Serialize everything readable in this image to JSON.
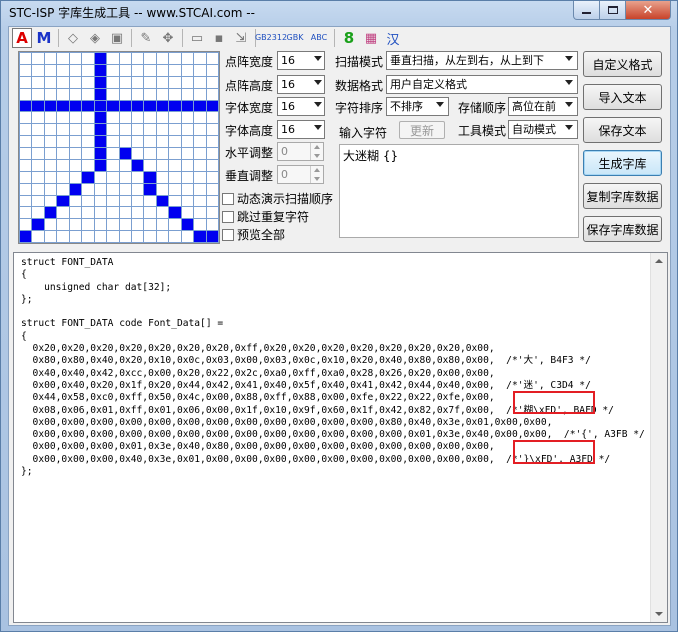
{
  "window": {
    "title": "STC-ISP 字库生成工具 -- www.STCAI.com --"
  },
  "toolbar": {
    "items": [
      "A",
      "M",
      "eraser-icon",
      "fill-icon",
      "stamp-icon",
      "pencil-icon",
      "move-icon",
      "open-icon",
      "save-icon",
      "export-icon",
      "GB2312",
      "GBK",
      "ABC",
      "8",
      "color-grid-icon",
      "汉"
    ]
  },
  "grid": {
    "rows": [
      "0000001000000000",
      "0000001000000000",
      "0000001000000000",
      "0000001000000000",
      "1111111111111111",
      "0000001000000000",
      "0000001000000000",
      "0000001000000000",
      "0000001010000000",
      "0000001001000000",
      "0000010000100000",
      "0000100000100000",
      "0001000000010000",
      "0010000000001000",
      "0100000000000100",
      "1000000000000011"
    ]
  },
  "settings": {
    "matrix_width_label": "点阵宽度",
    "matrix_width": "16",
    "matrix_height_label": "点阵高度",
    "matrix_height": "16",
    "font_width_label": "字体宽度",
    "font_width": "16",
    "font_height_label": "字体高度",
    "font_height": "16",
    "h_adjust_label": "水平调整",
    "h_adjust": "0",
    "v_adjust_label": "垂直调整",
    "v_adjust": "0"
  },
  "checkboxes": {
    "demo_scan": "动态演示扫描顺序",
    "skip_dup": "跳过重复字符",
    "preview_all": "预览全部"
  },
  "options": {
    "scan_mode_label": "扫描模式",
    "scan_mode": "垂直扫描，从左到右，从上到下",
    "data_format_label": "数据格式",
    "data_format": "用户自定义格式",
    "char_sort_label": "字符排序",
    "char_sort": "不排序",
    "storage_order_label": "存储顺序",
    "storage_order": "高位在前",
    "input_chars_label": "输入字符",
    "update_button": "更新",
    "tool_mode_label": "工具模式",
    "tool_mode": "自动模式"
  },
  "buttons": {
    "custom_format": "自定义格式",
    "import_text": "导入文本",
    "save_text": "保存文本",
    "generate": "生成字库",
    "copy_data": "复制字库数据",
    "save_data": "保存字库数据"
  },
  "input_text": "大迷糊 {}",
  "code": "struct FONT_DATA\n{\n    unsigned char dat[32];\n};\n\nstruct FONT_DATA code Font_Data[] =\n{\n  0x20,0x20,0x20,0x20,0x20,0x20,0x20,0xff,0x20,0x20,0x20,0x20,0x20,0x20,0x20,0x00,\n  0x80,0x80,0x40,0x20,0x10,0x0c,0x03,0x00,0x03,0x0c,0x10,0x20,0x40,0x80,0x80,0x00,  /*'大', B4F3 */\n  0x40,0x40,0x42,0xcc,0x00,0x20,0x22,0x2c,0xa0,0xff,0xa0,0x28,0x26,0x20,0x00,0x00,\n  0x00,0x40,0x20,0x1f,0x20,0x44,0x42,0x41,0x40,0x5f,0x40,0x41,0x42,0x44,0x40,0x00,  /*'迷', C3D4 */\n  0x44,0x58,0xc0,0xff,0x50,0x4c,0x00,0x88,0xff,0x88,0x00,0xfe,0x22,0x22,0xfe,0x00,\n  0x08,0x06,0x01,0xff,0x01,0x06,0x00,0x1f,0x10,0x9f,0x60,0x1f,0x42,0x82,0x7f,0x00,  /*'糊\\xFD', BAFD */\n  0x00,0x00,0x00,0x00,0x00,0x00,0x00,0x00,0x00,0x00,0x00,0x00,0x80,0x40,0x3e,0x01,0x00,0x00,\n  0x00,0x00,0x00,0x00,0x00,0x00,0x00,0x00,0x00,0x00,0x00,0x00,0x00,0x01,0x3e,0x40,0x00,0x00,  /*'{', A3FB */\n  0x00,0x00,0x00,0x01,0x3e,0x40,0x80,0x00,0x00,0x00,0x00,0x00,0x00,0x00,0x00,0x00,\n  0x00,0x00,0x00,0x40,0x3e,0x01,0x00,0x00,0x00,0x00,0x00,0x00,0x00,0x00,0x00,0x00,  /*'}\\xFD', A3FD */\n};",
  "colors": {
    "pixel_on": "#0000f0",
    "highlight": "#e31e24"
  }
}
